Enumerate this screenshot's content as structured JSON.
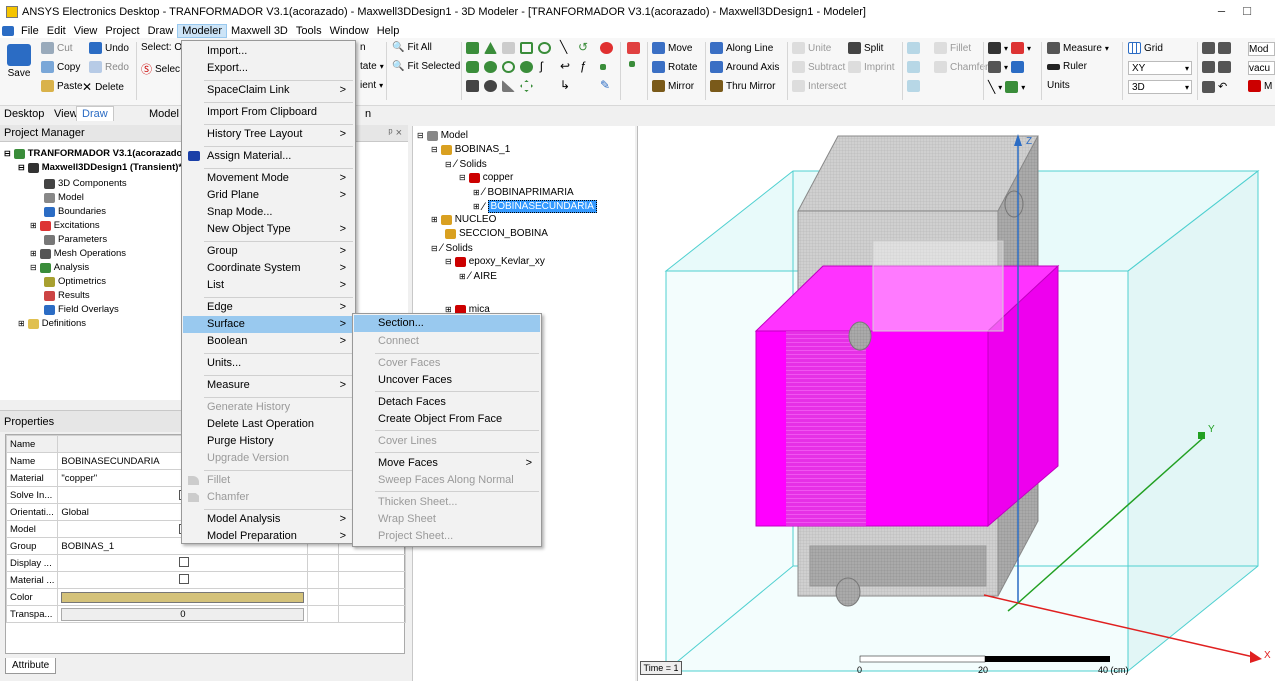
{
  "window": {
    "title": "ANSYS Electronics Desktop - TRANFORMADOR V3.1(acorazado) - Maxwell3DDesign1 - 3D Modeler - [TRANFORMADOR V3.1(acorazado) - Maxwell3DDesign1 - Modeler]",
    "minimize": "–",
    "restore": "□"
  },
  "menubar": [
    "File",
    "Edit",
    "View",
    "Project",
    "Draw",
    "Modeler",
    "Maxwell 3D",
    "Tools",
    "Window",
    "Help"
  ],
  "ribbon": {
    "save": "Save",
    "cut": "Cut",
    "undo": "Undo",
    "copy": "Copy",
    "redo": "Redo",
    "paste": "Paste",
    "delete": "Delete",
    "select_obj": "Select: Ol",
    "select": "Selec",
    "n_frag": "n",
    "state_frag": "tate",
    "ient_frag": "ient",
    "fit_all": "Fit All",
    "fit_selected": "Fit Selected",
    "move": "Move",
    "rotate": "Rotate",
    "mirror": "Mirror",
    "along_line": "Along Line",
    "around_axis": "Around Axis",
    "thru_mirror": "Thru Mirror",
    "unite": "Unite",
    "subtract": "Subtract",
    "intersect": "Intersect",
    "split": "Split",
    "imprint": "Imprint",
    "fillet": "Fillet",
    "chamfer": "Chamfer",
    "measure": "Measure",
    "ruler": "Ruler",
    "units": "Units",
    "grid": "Grid",
    "grid_plane": "XY",
    "grid_mode": "3D",
    "model_frag": "Mod",
    "vacuum_frag": "vacu",
    "m_frag": "M"
  },
  "tabs": [
    "Desktop",
    "View",
    "Draw",
    "Model",
    "n"
  ],
  "project_manager": {
    "title": "Project Manager",
    "pin": "ᵖ ×",
    "items": [
      "TRANFORMADOR V3.1(acorazado)",
      "Maxwell3DDesign1 (Transient)*",
      "3D Components",
      "Model",
      "Boundaries",
      "Excitations",
      "Parameters",
      "Mesh Operations",
      "Analysis",
      "Optimetrics",
      "Results",
      "Field Overlays",
      "Definitions"
    ]
  },
  "properties": {
    "title": "Properties",
    "headers": [
      "Name",
      "Valu"
    ],
    "rows": [
      {
        "name": "Name",
        "value": "BOBINASECUNDARIA"
      },
      {
        "name": "Material",
        "value": "\"copper\""
      },
      {
        "name": "Solve In...",
        "value": "✔"
      },
      {
        "name": "Orientati...",
        "value": "Global"
      },
      {
        "name": "Model",
        "value": "✔"
      },
      {
        "name": "Group",
        "value": "BOBINAS_1"
      },
      {
        "name": "Display ...",
        "value": ""
      },
      {
        "name": "Material ...",
        "value": ""
      },
      {
        "name": "Color",
        "value": ""
      },
      {
        "name": "Transpa...",
        "value": "0"
      }
    ],
    "attribute_tab": "Attribute"
  },
  "model_tree": [
    "Model",
    "BOBINAS_1",
    "Solids",
    "copper",
    "BOBINAPRIMARIA",
    "BOBINASECUNDARIA",
    "NUCLEO",
    "SECCION_BOBINA",
    "Solids",
    "epoxy_Kevlar_xy",
    "AIRE",
    "mica"
  ],
  "modeler_menu": [
    {
      "label": "Import...",
      "arrow": ""
    },
    {
      "label": "Export...",
      "arrow": ""
    },
    {
      "label": "SpaceClaim Link",
      "arrow": ">"
    },
    {
      "label": "Import From Clipboard",
      "arrow": ""
    },
    {
      "label": "History Tree Layout",
      "arrow": ">"
    },
    {
      "label": "Assign Material...",
      "arrow": ""
    },
    {
      "label": "Movement Mode",
      "arrow": ">"
    },
    {
      "label": "Grid Plane",
      "arrow": ">"
    },
    {
      "label": "Snap Mode...",
      "arrow": ""
    },
    {
      "label": "New Object Type",
      "arrow": ">"
    },
    {
      "label": "Group",
      "arrow": ">"
    },
    {
      "label": "Coordinate System",
      "arrow": ">"
    },
    {
      "label": "List",
      "arrow": ">"
    },
    {
      "label": "Edge",
      "arrow": ">"
    },
    {
      "label": "Surface",
      "arrow": ">"
    },
    {
      "label": "Boolean",
      "arrow": ">"
    },
    {
      "label": "Units...",
      "arrow": ""
    },
    {
      "label": "Measure",
      "arrow": ">"
    },
    {
      "label": "Generate History",
      "arrow": ""
    },
    {
      "label": "Delete Last Operation",
      "arrow": ""
    },
    {
      "label": "Purge History",
      "arrow": ""
    },
    {
      "label": "Upgrade Version",
      "arrow": ""
    },
    {
      "label": "Fillet",
      "arrow": ""
    },
    {
      "label": "Chamfer",
      "arrow": ""
    },
    {
      "label": "Model Analysis",
      "arrow": ">"
    },
    {
      "label": "Model Preparation",
      "arrow": ">"
    }
  ],
  "surface_menu": [
    {
      "label": "Section...",
      "arrow": ""
    },
    {
      "label": "Connect",
      "arrow": ""
    },
    {
      "label": "Cover Faces",
      "arrow": ""
    },
    {
      "label": "Uncover Faces",
      "arrow": ""
    },
    {
      "label": "Detach Faces",
      "arrow": ""
    },
    {
      "label": "Create Object From Face",
      "arrow": ""
    },
    {
      "label": "Cover Lines",
      "arrow": ""
    },
    {
      "label": "Move Faces",
      "arrow": ">"
    },
    {
      "label": "Sweep Faces Along Normal",
      "arrow": ""
    },
    {
      "label": "Thicken Sheet...",
      "arrow": ""
    },
    {
      "label": "Wrap Sheet",
      "arrow": ""
    },
    {
      "label": "Project Sheet...",
      "arrow": ""
    }
  ],
  "viewport": {
    "time": "Time = 1",
    "scale_0": "0",
    "scale_20": "20",
    "scale_40": "40 (cm)",
    "axis_x": "X",
    "axis_y": "Y",
    "axis_z": "Z"
  },
  "colors": {
    "accent": "#3399ff",
    "coil": "#ff00ff",
    "core": "#c8c8c8",
    "menu_highlight": "#99c9ef",
    "grid_lines": "#66d9d9",
    "color_swatch": "#d4c27a"
  }
}
